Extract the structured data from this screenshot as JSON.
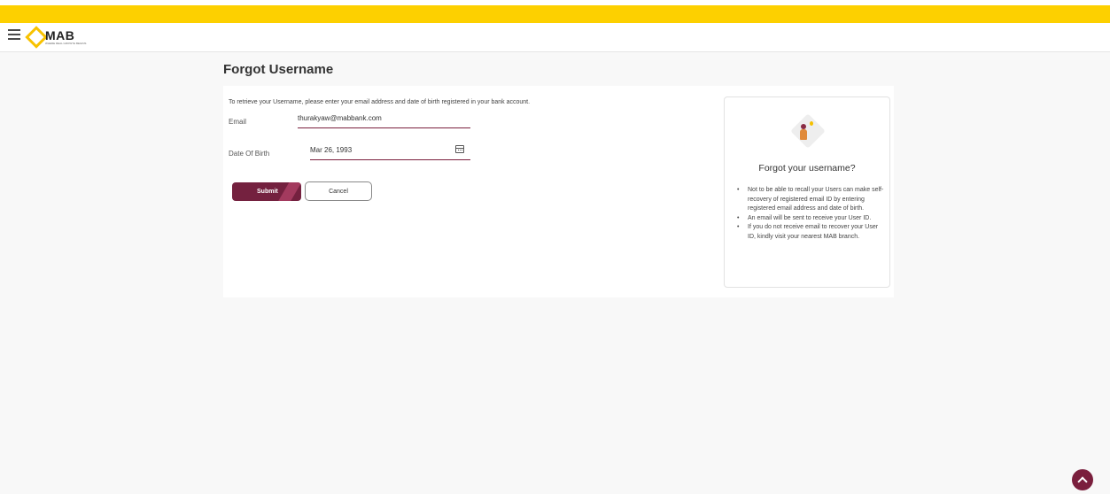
{
  "header": {
    "menu_icon": "hamburger-menu-icon",
    "logo_text": "MAB",
    "logo_tagline": "WHERE REAL GROWTH BEGINS",
    "accent_yellow": "#fdd000",
    "brand_maroon": "#74213f"
  },
  "page": {
    "title": "Forgot Username"
  },
  "form": {
    "instruction": "To retrieve your Username, please enter your email address and date of birth registered in your bank account.",
    "email_label": "Email",
    "email_value": "thurakyaw@mabbank.com",
    "dob_label": "Date Of Birth",
    "dob_value": "Mar 26, 1993",
    "calendar_icon": "calendar-icon",
    "submit_label": "Submit",
    "cancel_label": "Cancel"
  },
  "help": {
    "title": "Forgot your username?",
    "items": [
      "Not to be able to recall your Users can make self-recovery of registered email ID by entering registered email address and date of birth.",
      "An email will be sent to receive your User ID.",
      "If you do not receive email to recover your User ID, kindly visit your nearest MAB branch."
    ]
  },
  "scroll_top_icon": "chevron-up-icon"
}
